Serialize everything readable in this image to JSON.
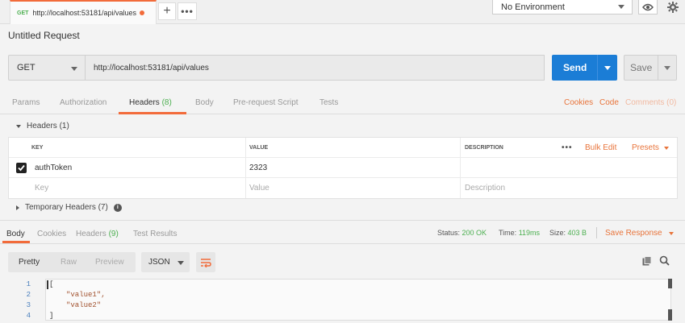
{
  "tab": {
    "method": "GET",
    "url": "http://localhost:53181/api/values",
    "plus": "+",
    "more": "•••"
  },
  "environment": {
    "selected": "No Environment"
  },
  "request": {
    "title": "Untitled Request",
    "method": "GET",
    "url": "http://localhost:53181/api/values",
    "send_label": "Send",
    "save_label": "Save"
  },
  "request_tabs": {
    "params": "Params",
    "authorization": "Authorization",
    "headers": "Headers",
    "headers_count": "(8)",
    "body": "Body",
    "prerequest": "Pre-request Script",
    "tests": "Tests",
    "cookies": "Cookies",
    "code": "Code",
    "comments": "Comments (0)"
  },
  "headers_section": {
    "label": "Headers (1)",
    "columns": {
      "key": "KEY",
      "value": "VALUE",
      "description": "DESCRIPTION"
    },
    "more": "•••",
    "bulk_edit": "Bulk Edit",
    "presets": "Presets",
    "rows": [
      {
        "key": "authToken",
        "value": "2323",
        "description": ""
      }
    ],
    "placeholders": {
      "key": "Key",
      "value": "Value",
      "description": "Description"
    },
    "temporary": "Temporary Headers (7)"
  },
  "response_tabs": {
    "body": "Body",
    "cookies": "Cookies",
    "headers": "Headers",
    "headers_count": "(9)",
    "test_results": "Test Results",
    "status_label": "Status:",
    "status_value": "200 OK",
    "time_label": "Time:",
    "time_value": "119ms",
    "size_label": "Size:",
    "size_value": "403 B",
    "save_response": "Save Response"
  },
  "response_toolbar": {
    "pretty": "Pretty",
    "raw": "Raw",
    "preview": "Preview",
    "format": "JSON"
  },
  "response_body": {
    "lines": [
      {
        "n": "1",
        "text": "["
      },
      {
        "n": "2",
        "text": "\"value1\","
      },
      {
        "n": "3",
        "text": "\"value2\""
      },
      {
        "n": "4",
        "text": "]"
      }
    ]
  },
  "colors": {
    "accent": "#f26b3a",
    "send": "#1b7dd6",
    "success": "#4caf50",
    "link": "#e8743b"
  }
}
